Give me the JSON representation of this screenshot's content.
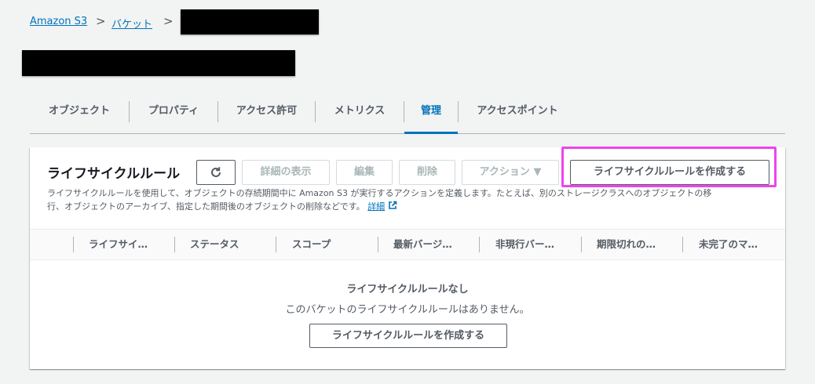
{
  "breadcrumb": {
    "items": [
      "Amazon S3",
      "バケット"
    ],
    "separator": ">"
  },
  "tabs": [
    "オブジェクト",
    "プロパティ",
    "アクセス許可",
    "メトリクス",
    "管理",
    "アクセスポイント"
  ],
  "active_tab": "管理",
  "lifecycle": {
    "title": "ライフサイクルルール",
    "refresh_icon": "refresh-icon",
    "buttons": {
      "view_details": "詳細の表示",
      "edit": "編集",
      "delete": "削除",
      "actions": "アクション ▼",
      "create": "ライフサイクルルールを作成する"
    },
    "description_line1": "ライフサイクルルールを使用して、オブジェクトの存続期間中に Amazon S3 が実行するアクションを定義します。たとえば、別のストレージクラスへのオブジェクトの移",
    "description_line2": "行、オブジェクトのアーカイブ、指定した期間後のオブジェクトの削除などです。",
    "learn_more": "詳細",
    "columns": [
      "ライフサイ…",
      "ステータス",
      "スコープ",
      "最新バージ…",
      "非現行バー…",
      "期限切れの…",
      "未完了のマ…"
    ],
    "empty_title": "ライフサイクルルールなし",
    "empty_message": "このバケットのライフサイクルルールはありません。",
    "empty_create": "ライフサイクルルールを作成する"
  },
  "colors": {
    "link": "#0073bb",
    "highlight": "#ee44ee",
    "background": "#f2f3f3"
  }
}
